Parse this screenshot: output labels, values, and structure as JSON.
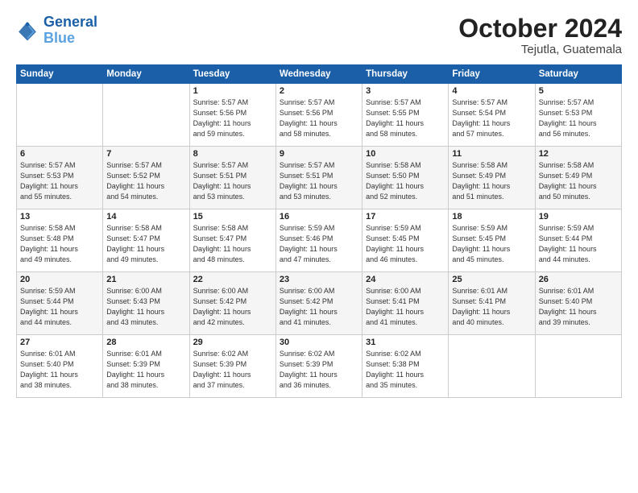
{
  "logo": {
    "line1": "General",
    "line2": "Blue"
  },
  "header": {
    "month_year": "October 2024",
    "location": "Tejutla, Guatemala"
  },
  "days_of_week": [
    "Sunday",
    "Monday",
    "Tuesday",
    "Wednesday",
    "Thursday",
    "Friday",
    "Saturday"
  ],
  "weeks": [
    [
      {
        "day": "",
        "detail": ""
      },
      {
        "day": "",
        "detail": ""
      },
      {
        "day": "1",
        "detail": "Sunrise: 5:57 AM\nSunset: 5:56 PM\nDaylight: 11 hours\nand 59 minutes."
      },
      {
        "day": "2",
        "detail": "Sunrise: 5:57 AM\nSunset: 5:56 PM\nDaylight: 11 hours\nand 58 minutes."
      },
      {
        "day": "3",
        "detail": "Sunrise: 5:57 AM\nSunset: 5:55 PM\nDaylight: 11 hours\nand 58 minutes."
      },
      {
        "day": "4",
        "detail": "Sunrise: 5:57 AM\nSunset: 5:54 PM\nDaylight: 11 hours\nand 57 minutes."
      },
      {
        "day": "5",
        "detail": "Sunrise: 5:57 AM\nSunset: 5:53 PM\nDaylight: 11 hours\nand 56 minutes."
      }
    ],
    [
      {
        "day": "6",
        "detail": "Sunrise: 5:57 AM\nSunset: 5:53 PM\nDaylight: 11 hours\nand 55 minutes."
      },
      {
        "day": "7",
        "detail": "Sunrise: 5:57 AM\nSunset: 5:52 PM\nDaylight: 11 hours\nand 54 minutes."
      },
      {
        "day": "8",
        "detail": "Sunrise: 5:57 AM\nSunset: 5:51 PM\nDaylight: 11 hours\nand 53 minutes."
      },
      {
        "day": "9",
        "detail": "Sunrise: 5:57 AM\nSunset: 5:51 PM\nDaylight: 11 hours\nand 53 minutes."
      },
      {
        "day": "10",
        "detail": "Sunrise: 5:58 AM\nSunset: 5:50 PM\nDaylight: 11 hours\nand 52 minutes."
      },
      {
        "day": "11",
        "detail": "Sunrise: 5:58 AM\nSunset: 5:49 PM\nDaylight: 11 hours\nand 51 minutes."
      },
      {
        "day": "12",
        "detail": "Sunrise: 5:58 AM\nSunset: 5:49 PM\nDaylight: 11 hours\nand 50 minutes."
      }
    ],
    [
      {
        "day": "13",
        "detail": "Sunrise: 5:58 AM\nSunset: 5:48 PM\nDaylight: 11 hours\nand 49 minutes."
      },
      {
        "day": "14",
        "detail": "Sunrise: 5:58 AM\nSunset: 5:47 PM\nDaylight: 11 hours\nand 49 minutes."
      },
      {
        "day": "15",
        "detail": "Sunrise: 5:58 AM\nSunset: 5:47 PM\nDaylight: 11 hours\nand 48 minutes."
      },
      {
        "day": "16",
        "detail": "Sunrise: 5:59 AM\nSunset: 5:46 PM\nDaylight: 11 hours\nand 47 minutes."
      },
      {
        "day": "17",
        "detail": "Sunrise: 5:59 AM\nSunset: 5:45 PM\nDaylight: 11 hours\nand 46 minutes."
      },
      {
        "day": "18",
        "detail": "Sunrise: 5:59 AM\nSunset: 5:45 PM\nDaylight: 11 hours\nand 45 minutes."
      },
      {
        "day": "19",
        "detail": "Sunrise: 5:59 AM\nSunset: 5:44 PM\nDaylight: 11 hours\nand 44 minutes."
      }
    ],
    [
      {
        "day": "20",
        "detail": "Sunrise: 5:59 AM\nSunset: 5:44 PM\nDaylight: 11 hours\nand 44 minutes."
      },
      {
        "day": "21",
        "detail": "Sunrise: 6:00 AM\nSunset: 5:43 PM\nDaylight: 11 hours\nand 43 minutes."
      },
      {
        "day": "22",
        "detail": "Sunrise: 6:00 AM\nSunset: 5:42 PM\nDaylight: 11 hours\nand 42 minutes."
      },
      {
        "day": "23",
        "detail": "Sunrise: 6:00 AM\nSunset: 5:42 PM\nDaylight: 11 hours\nand 41 minutes."
      },
      {
        "day": "24",
        "detail": "Sunrise: 6:00 AM\nSunset: 5:41 PM\nDaylight: 11 hours\nand 41 minutes."
      },
      {
        "day": "25",
        "detail": "Sunrise: 6:01 AM\nSunset: 5:41 PM\nDaylight: 11 hours\nand 40 minutes."
      },
      {
        "day": "26",
        "detail": "Sunrise: 6:01 AM\nSunset: 5:40 PM\nDaylight: 11 hours\nand 39 minutes."
      }
    ],
    [
      {
        "day": "27",
        "detail": "Sunrise: 6:01 AM\nSunset: 5:40 PM\nDaylight: 11 hours\nand 38 minutes."
      },
      {
        "day": "28",
        "detail": "Sunrise: 6:01 AM\nSunset: 5:39 PM\nDaylight: 11 hours\nand 38 minutes."
      },
      {
        "day": "29",
        "detail": "Sunrise: 6:02 AM\nSunset: 5:39 PM\nDaylight: 11 hours\nand 37 minutes."
      },
      {
        "day": "30",
        "detail": "Sunrise: 6:02 AM\nSunset: 5:39 PM\nDaylight: 11 hours\nand 36 minutes."
      },
      {
        "day": "31",
        "detail": "Sunrise: 6:02 AM\nSunset: 5:38 PM\nDaylight: 11 hours\nand 35 minutes."
      },
      {
        "day": "",
        "detail": ""
      },
      {
        "day": "",
        "detail": ""
      }
    ]
  ]
}
